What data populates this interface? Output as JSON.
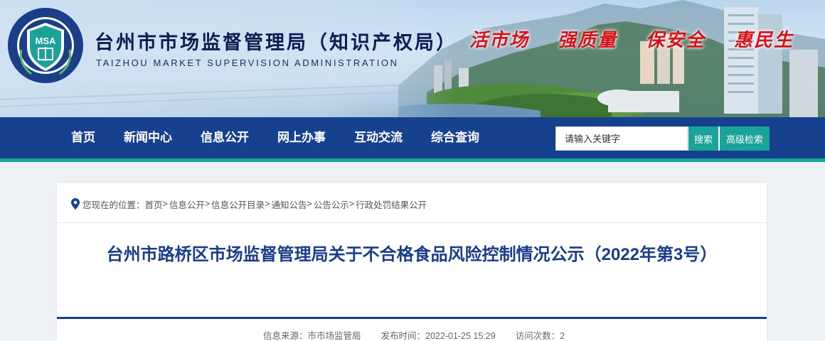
{
  "header": {
    "logo_text": "MSA",
    "logo_ring_text": "TAIZHOU MARKET SUPERVISION ADMINISTRATION",
    "title_cn": "台州市市场监督管理局（知识产权局）",
    "title_en": "TAIZHOU MARKET SUPERVISION ADMINISTRATION",
    "slogans": [
      "活市场",
      "强质量",
      "保安全",
      "惠民生"
    ],
    "slogan_color": "#d4121b"
  },
  "nav": {
    "items": [
      "首页",
      "新闻中心",
      "信息公开",
      "网上办事",
      "互动交流",
      "综合查询"
    ],
    "bg_color": "#16418f",
    "accent_color": "#1aa39a"
  },
  "search": {
    "placeholder": "请输入关键字",
    "search_label": "搜索",
    "advanced_label": "高级检索"
  },
  "breadcrumb": {
    "prefix": "您现在的位置：",
    "items": [
      "首页",
      "信息公开",
      "信息公开目录",
      "通知公告",
      "公告公示",
      "行政处罚结果公开"
    ],
    "separator": ">"
  },
  "article": {
    "title": "台州市路桥区市场监督管理局关于不合格食品风险控制情况公示（2022年第3号）",
    "source": "信息来源：市市场监管局",
    "published": "发布时间：2022-01-25 15:29",
    "views": "访问次数：2"
  }
}
